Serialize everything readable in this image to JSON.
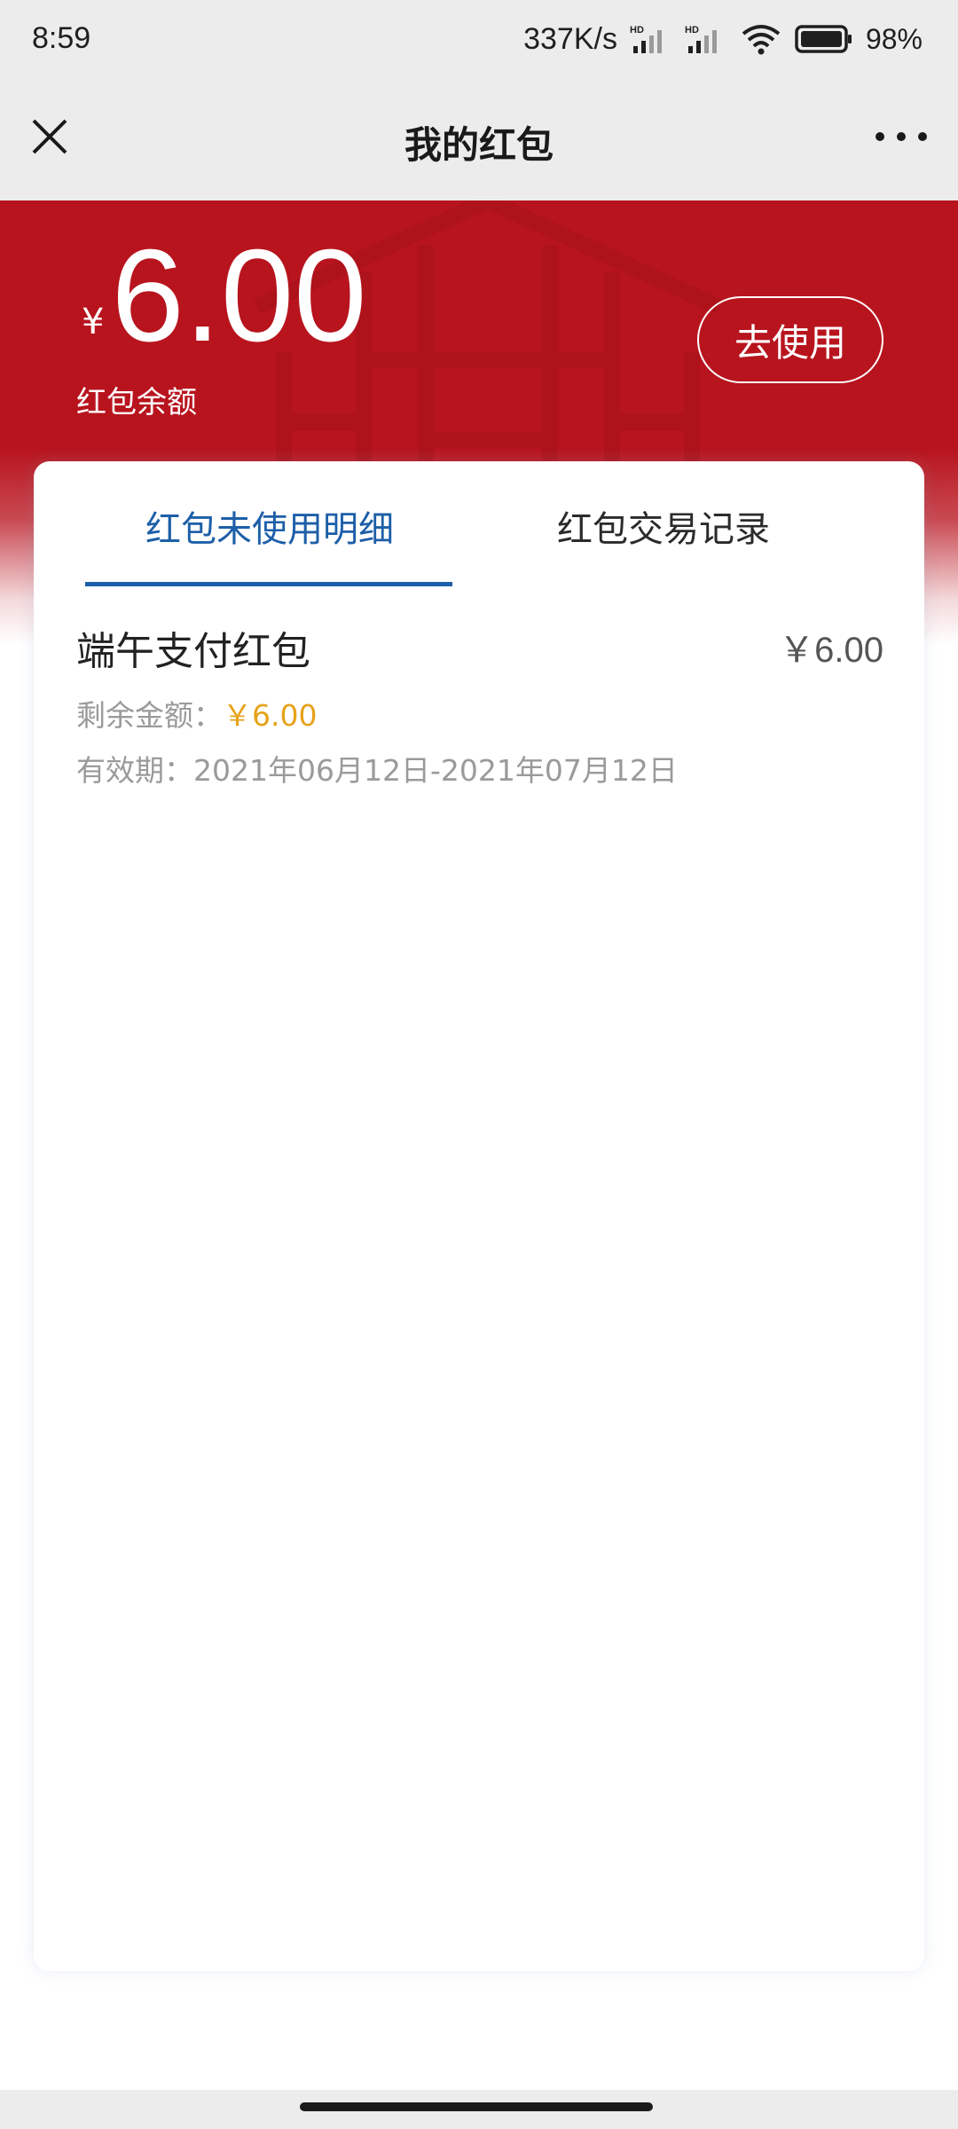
{
  "status_bar": {
    "time": "8:59",
    "speed": "337K/s",
    "battery": "98%"
  },
  "nav": {
    "title": "我的红包",
    "close_icon": "close-icon",
    "more_icon": "more-icon"
  },
  "hero": {
    "currency": "¥",
    "amount": "6.00",
    "label": "红包余额",
    "button": "去使用"
  },
  "tabs": [
    {
      "label": "红包未使用明细",
      "active": true
    },
    {
      "label": "红包交易记录",
      "active": false
    }
  ],
  "items": [
    {
      "title": "端午支付红包",
      "amount": "￥6.00",
      "remaining_label": "剩余金额：",
      "remaining_value": "￥6.00",
      "validity": "有效期：2021年06月12日-2021年07月12日"
    }
  ],
  "colors": {
    "accent_red": "#b8141e",
    "tab_blue": "#1d5fa8",
    "remaining_orange": "#e6a21a"
  }
}
